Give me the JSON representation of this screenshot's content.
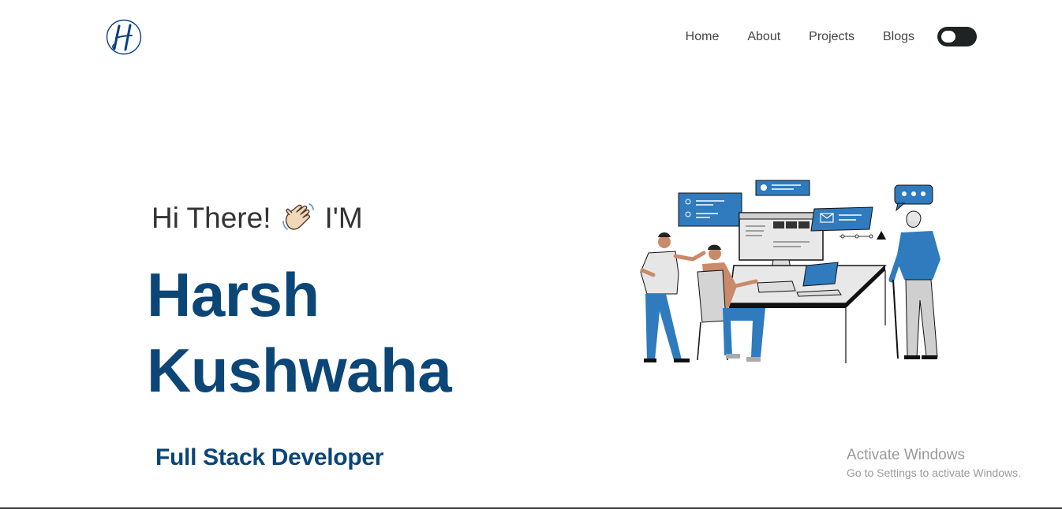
{
  "header": {
    "logo_letter": "H",
    "nav": [
      "Home",
      "About",
      "Projects",
      "Blogs"
    ],
    "theme_toggle": "dark-mode-toggle"
  },
  "hero": {
    "greeting_start": "Hi There!",
    "greeting_emoji": "waving-hand-icon",
    "greeting_end": "I'M",
    "first_name": "Harsh",
    "last_name": "Kushwaha",
    "role": "Full Stack Developer"
  },
  "watermark": {
    "title": "Activate Windows",
    "subtitle": "Go to Settings to activate Windows."
  },
  "colors": {
    "brand_blue": "#0b4677",
    "illustration_blue": "#2f7bbd",
    "toggle_dark": "#1f2323"
  }
}
